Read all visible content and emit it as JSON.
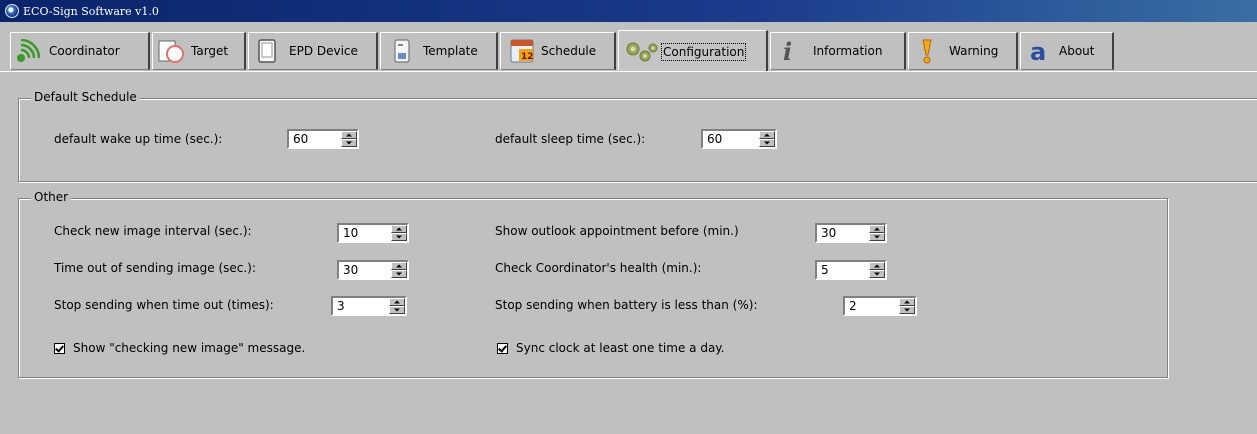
{
  "window": {
    "title": "ECO-Sign Software v1.0",
    "icon": "app-icon"
  },
  "tabs": [
    {
      "label": "Coordinator",
      "icon": "signal-icon"
    },
    {
      "label": "Target",
      "icon": "target-icon"
    },
    {
      "label": "EPD Device",
      "icon": "epd-device-icon"
    },
    {
      "label": "Template",
      "icon": "template-icon"
    },
    {
      "label": "Schedule",
      "icon": "calendar-icon"
    },
    {
      "label": "Configuration",
      "icon": "gears-icon",
      "active": true
    },
    {
      "label": "Information",
      "icon": "info-icon"
    },
    {
      "label": "Warning",
      "icon": "warning-icon"
    },
    {
      "label": "About",
      "icon": "about-icon"
    }
  ],
  "default_schedule": {
    "title": "Default Schedule",
    "wake_label": "default wake up  time (sec.):",
    "wake_value": "60",
    "sleep_label": "default sleep time (sec.):",
    "sleep_value": "60"
  },
  "other": {
    "title": "Other",
    "check_interval_label": "Check new image interval (sec.):",
    "check_interval_value": "10",
    "timeout_label": "Time out of sending image (sec.):",
    "timeout_value": "30",
    "stop_timeout_label": "Stop sending when time out (times):",
    "stop_timeout_value": "3",
    "outlook_label": "Show outlook appointment before (min.)",
    "outlook_value": "30",
    "health_label": "Check Coordinator's health (min.):",
    "health_value": "5",
    "battery_label": "Stop sending when battery is less than (%):",
    "battery_value": "2",
    "show_msg_label": "Show \"checking new image\" message.",
    "show_msg_checked": true,
    "sync_clock_label": "Sync clock at least  one time a day.",
    "sync_clock_checked": true
  },
  "colors": {
    "window_bg": "#c0c0c0",
    "title_bar": "#0a246a",
    "title_text": "#ffffff"
  }
}
